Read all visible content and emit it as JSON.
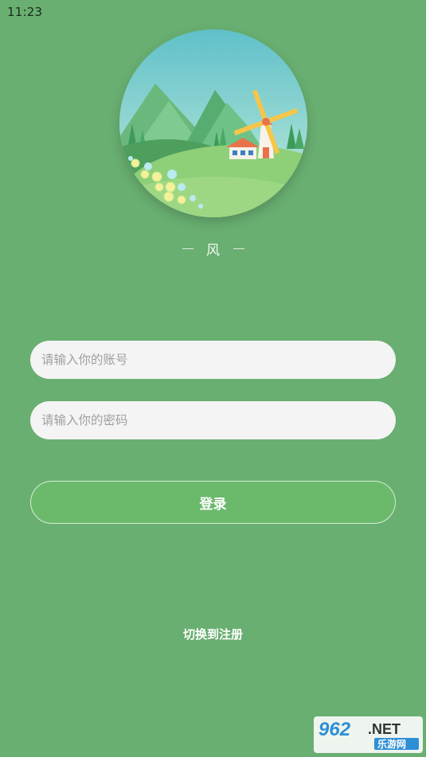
{
  "status_bar": {
    "time": "11:23"
  },
  "app": {
    "name": "风"
  },
  "form": {
    "account_placeholder": "请输入你的账号",
    "password_placeholder": "请输入你的密码",
    "login_label": "登录",
    "switch_label": "切换到注册"
  },
  "watermark": {
    "brand": "962",
    "suffix": ".NET",
    "subtitle": "乐游网"
  },
  "colors": {
    "background": "#69AF71",
    "input_bg": "#F4F4F4",
    "button_bg": "#6BBA6C",
    "placeholder": "#A0A0A0"
  }
}
